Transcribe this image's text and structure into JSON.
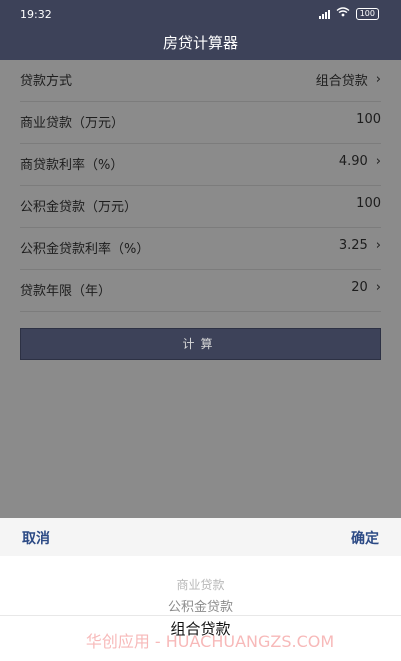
{
  "status_bar": {
    "time": "19:32",
    "battery": "100"
  },
  "header": {
    "title": "房贷计算器"
  },
  "form": {
    "rows": [
      {
        "label": "贷款方式",
        "value": "组合贷款",
        "chevron": true
      },
      {
        "label": "商业贷款（万元）",
        "value": "100",
        "chevron": false
      },
      {
        "label": "商贷款利率（%）",
        "value": "4.90",
        "chevron": true
      },
      {
        "label": "公积金贷款（万元）",
        "value": "100",
        "chevron": false
      },
      {
        "label": "公积金贷款利率（%）",
        "value": "3.25",
        "chevron": true
      },
      {
        "label": "贷款年限（年）",
        "value": "20",
        "chevron": true
      }
    ],
    "calculate_label": "计算"
  },
  "picker": {
    "cancel_label": "取消",
    "confirm_label": "确定",
    "options": [
      "商业贷款",
      "公积金贷款",
      "组合贷款"
    ],
    "selected": "组合贷款"
  },
  "watermark": "华创应用 - HUACHUANGZS.COM"
}
